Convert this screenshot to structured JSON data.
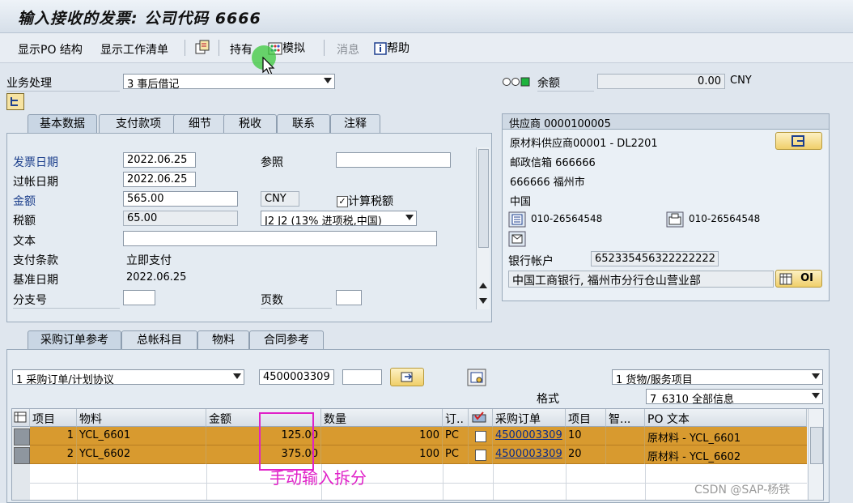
{
  "window": {
    "title": "输入接收的发票: 公司代码 6666"
  },
  "toolbar": {
    "show_po_structure": "显示PO 结构",
    "show_worklist": "显示工作清单",
    "hold": "持有",
    "simulate": "模拟",
    "messages": "消息",
    "help": "帮助"
  },
  "header": {
    "transaction_label": "业务处理",
    "transaction_value": "3 事后借记",
    "balance_label": "余额",
    "balance_value": "0.00",
    "balance_currency": "CNY"
  },
  "basic_tabs": [
    "基本数据",
    "支付款项",
    "细节",
    "税收",
    "联系",
    "注释"
  ],
  "basic": {
    "invoice_date_label": "发票日期",
    "invoice_date": "2022.06.25",
    "reference_label": "参照",
    "reference": "",
    "posting_date_label": "过帐日期",
    "posting_date": "2022.06.25",
    "amount_label": "金额",
    "amount": "565.00",
    "currency": "CNY",
    "calc_tax_label": "计算税额",
    "calc_tax_checked": true,
    "tax_amount_label": "税额",
    "tax_amount": "65.00",
    "tax_code": "J2 J2 (13% 进项税,中国)",
    "text_label": "文本",
    "text": "",
    "payment_terms_label": "支付条款",
    "payment_terms": "立即支付",
    "baseline_date_label": "基准日期",
    "baseline_date": "2022.06.25",
    "branch_label": "分支号",
    "branch": "",
    "page_label": "页数",
    "page": ""
  },
  "vendor": {
    "header": "供应商 0000100005",
    "name": "原材料供应商00001 - DL2201",
    "pobox": "邮政信箱 666666",
    "city": "666666 福州市",
    "country": "中国",
    "phone": "010-26564548",
    "fax": "010-26564548",
    "bank_account_label": "银行帐户",
    "bank_account": "652335456322222222",
    "bank_name": "中国工商银行, 福州市分行仓山营业部",
    "oi_button": "OI"
  },
  "po_tabs": [
    "采购订单参考",
    "总帐科目",
    "物料",
    "合同参考"
  ],
  "po": {
    "ref_type": "1 采购订单/计划协议",
    "po_number": "4500003309",
    "po_item": "",
    "item_type": "1 货物/服务项目",
    "layout_label": "格式",
    "layout": "7_6310 全部信息"
  },
  "grid": {
    "columns": [
      "项目",
      "物料",
      "金额",
      "数量",
      "订..",
      "采购订单",
      "项目",
      "智...",
      "PO 文本"
    ],
    "rows": [
      {
        "item": "1",
        "material": "YCL_6601",
        "amount": "125.00",
        "qty": "100",
        "unit": "PC",
        "po": "4500003309",
        "po_item": "10",
        "text": "原材料 - YCL_6601"
      },
      {
        "item": "2",
        "material": "YCL_6602",
        "amount": "375.00",
        "qty": "100",
        "unit": "PC",
        "po": "4500003309",
        "po_item": "20",
        "text": "原材料 - YCL_6602"
      }
    ]
  },
  "annotation": {
    "text": "手动输入拆分",
    "color": "#e020c8"
  },
  "watermark": "CSDN @SAP-杨铁"
}
